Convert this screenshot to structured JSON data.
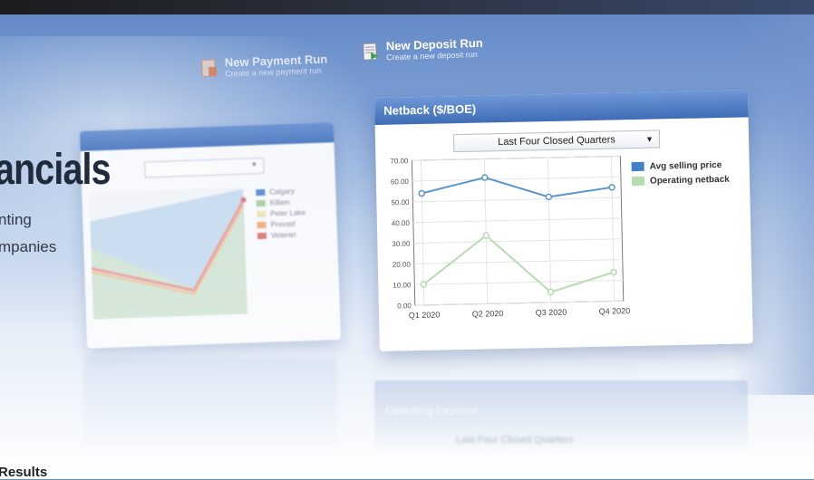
{
  "quick_actions": [
    {
      "title": "New Payment Run",
      "subtitle": "Create a new payment run",
      "icon": "payment-run-icon"
    },
    {
      "title": "New Deposit Run",
      "subtitle": "Create a new deposit run",
      "icon": "deposit-run-icon"
    }
  ],
  "hero": {
    "heading": "ancials",
    "desc_line1": "nting",
    "desc_line2": "mpanies",
    "results": "Results"
  },
  "left_panel": {
    "legend": [
      {
        "name": "Calgary",
        "color": "#5b8fd0"
      },
      {
        "name": "Killam",
        "color": "#a9d4a0"
      },
      {
        "name": "Peter Lake",
        "color": "#f2e6b8"
      },
      {
        "name": "Provost",
        "color": "#f3b27a"
      },
      {
        "name": "Veteran",
        "color": "#e07a7a"
      }
    ]
  },
  "main_panel": {
    "title": "Netback ($/BOE)",
    "dropdown_value": "Last Four Closed Quarters"
  },
  "chart_data": {
    "type": "line",
    "title": "Netback ($/BOE)",
    "categories": [
      "Q1 2020",
      "Q2 2020",
      "Q3 2020",
      "Q4 2020"
    ],
    "yticks": [
      "0.00",
      "10.00",
      "20.00",
      "30.00",
      "40.00",
      "50.00",
      "60.00",
      "70.00"
    ],
    "ylim": [
      0,
      70
    ],
    "series": [
      {
        "name": "Avg selling price",
        "color": "#5b95cf",
        "values": [
          54,
          61,
          51,
          55
        ]
      },
      {
        "name": "Operating netback",
        "color": "#b6dcb0",
        "values": [
          10,
          33,
          5,
          14
        ]
      }
    ],
    "legend_placement": "right"
  },
  "ghost_panel": {
    "title": "Operating Expense",
    "dropdown_value": "Last Four Closed Quarters"
  }
}
